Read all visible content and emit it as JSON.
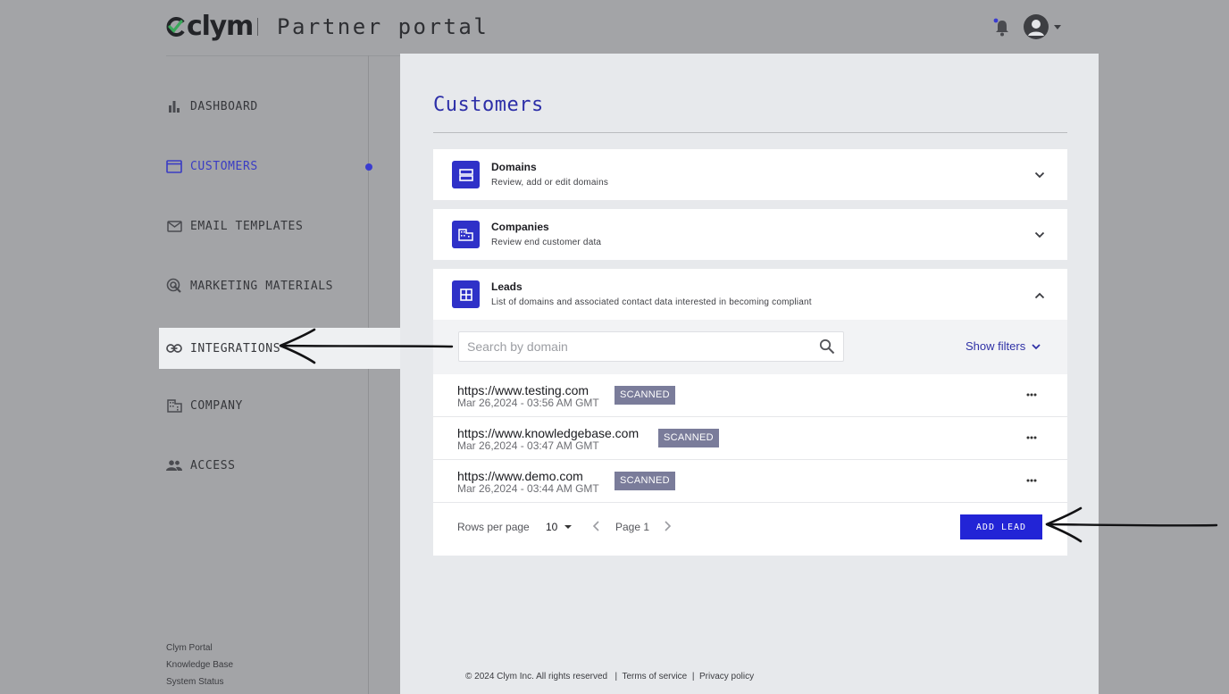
{
  "header": {
    "logo_text": "clym",
    "portal_title": "Partner portal"
  },
  "sidebar": {
    "items": [
      {
        "label": "DASHBOARD",
        "icon": "bar-chart-icon"
      },
      {
        "label": "CUSTOMERS",
        "icon": "folder-icon",
        "active": true
      },
      {
        "label": "EMAIL TEMPLATES",
        "icon": "mail-icon"
      },
      {
        "label": "MARKETING MATERIALS",
        "icon": "target-cursor-icon"
      },
      {
        "label": "INTEGRATIONS",
        "icon": "link-icon",
        "highlighted": true
      },
      {
        "label": "COMPANY",
        "icon": "building-icon"
      },
      {
        "label": "ACCESS",
        "icon": "people-icon"
      }
    ],
    "footer_links": [
      "Clym Portal",
      "Knowledge Base",
      "System Status"
    ]
  },
  "main": {
    "title": "Customers",
    "sections": [
      {
        "title": "Domains",
        "subtitle": "Review, add or edit domains",
        "icon": "dns-icon",
        "expanded": false
      },
      {
        "title": "Companies",
        "subtitle": "Review end customer data",
        "icon": "building-icon",
        "expanded": false
      },
      {
        "title": "Leads",
        "subtitle": "List of domains and associated contact data interested in becoming compliant",
        "icon": "grid-icon",
        "expanded": true
      }
    ],
    "leads": {
      "search_placeholder": "Search by domain",
      "show_filters_label": "Show filters",
      "rows": [
        {
          "url": "https://www.testing.com",
          "date": "Mar 26,2024 - 03:56 AM GMT",
          "status": "SCANNED"
        },
        {
          "url": "https://www.knowledgebase.com",
          "date": "Mar 26,2024 - 03:47 AM GMT",
          "status": "SCANNED"
        },
        {
          "url": "https://www.demo.com",
          "date": "Mar 26,2024 - 03:44 AM GMT",
          "status": "SCANNED"
        }
      ],
      "rows_per_page_label": "Rows per page",
      "rows_per_page_value": "10",
      "page_label": "Page 1",
      "add_lead_label": "ADD LEAD"
    }
  },
  "footer": {
    "copyright": "© 2024 Clym Inc. All rights reserved",
    "separator": "|",
    "terms": "Terms of service",
    "privacy": "Privacy policy"
  },
  "colors": {
    "accent": "#2f31c8",
    "button": "#2224d6",
    "badge": "#7a7c9a",
    "page_bg": "#a3a4a7"
  }
}
